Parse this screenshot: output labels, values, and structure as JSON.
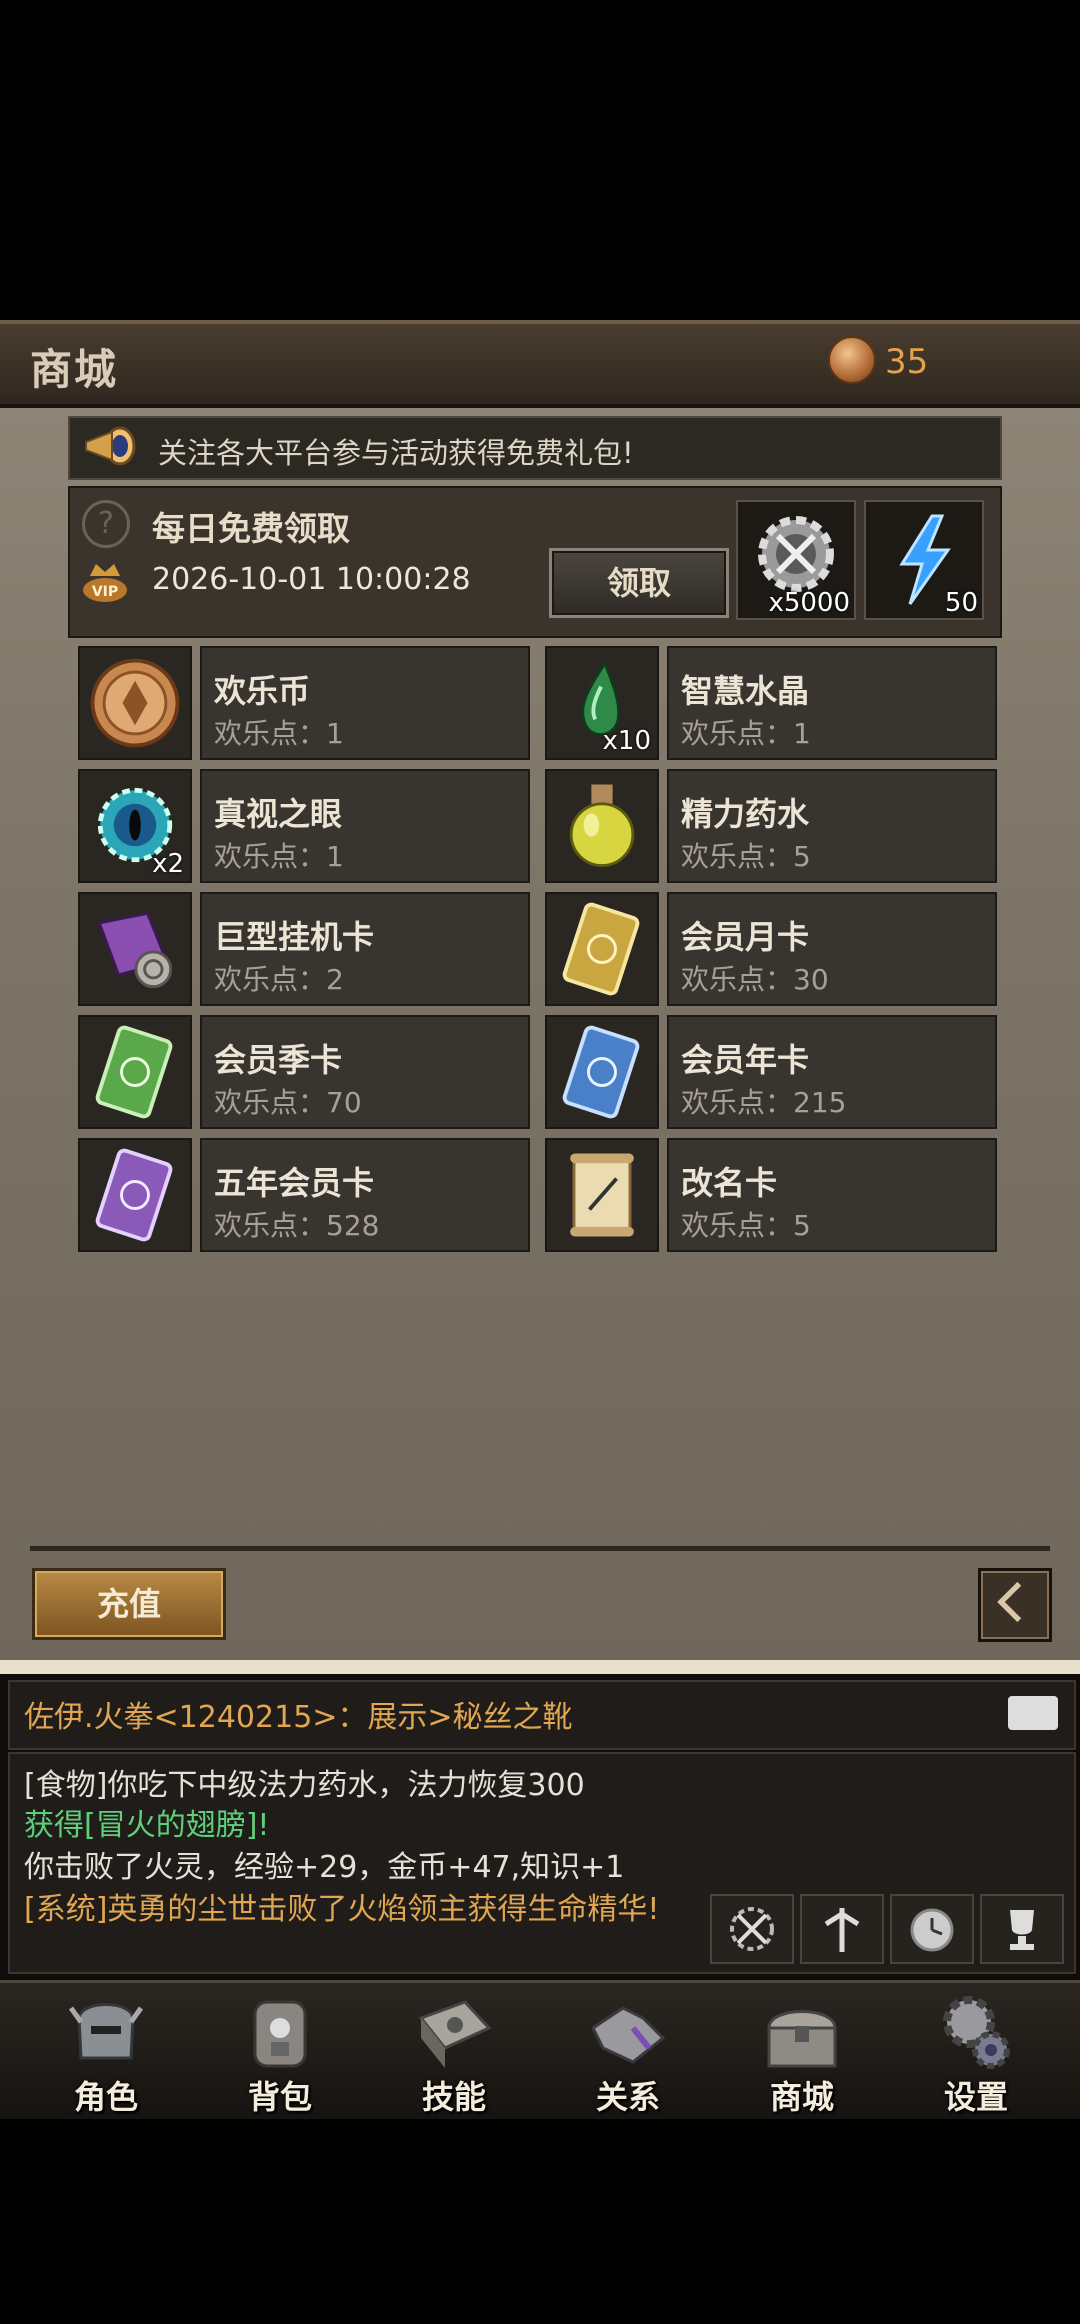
{
  "header": {
    "title": "商城",
    "currency_value": "35"
  },
  "notice": {
    "text": "关注各大平台参与活动获得免费礼包!"
  },
  "daily": {
    "title": "每日免费领取",
    "time": "2026-10-01 10:00:28",
    "claim_label": "领取",
    "rewards": [
      {
        "icon": "gear-swords-icon",
        "qty": "x5000"
      },
      {
        "icon": "lightning-icon",
        "qty": "50"
      }
    ]
  },
  "shop": {
    "items": [
      {
        "name": "欢乐币",
        "price": "欢乐点：1",
        "qty": "",
        "icon": "coin-icon"
      },
      {
        "name": "智慧水晶",
        "price": "欢乐点：1",
        "qty": "x10",
        "icon": "green-crystal-icon"
      },
      {
        "name": "真视之眼",
        "price": "欢乐点：1",
        "qty": "x2",
        "icon": "eye-icon"
      },
      {
        "name": "精力药水",
        "price": "欢乐点：5",
        "qty": "",
        "icon": "potion-icon"
      },
      {
        "name": "巨型挂机卡",
        "price": "欢乐点：2",
        "qty": "",
        "icon": "scroll-icon"
      },
      {
        "name": "会员月卡",
        "price": "欢乐点：30",
        "qty": "",
        "icon": "gold-card-icon"
      },
      {
        "name": "会员季卡",
        "price": "欢乐点：70",
        "qty": "",
        "icon": "green-card-icon"
      },
      {
        "name": "会员年卡",
        "price": "欢乐点：215",
        "qty": "",
        "icon": "blue-card-icon"
      },
      {
        "name": "五年会员卡",
        "price": "欢乐点：528",
        "qty": "",
        "icon": "purple-card-icon"
      },
      {
        "name": "改名卡",
        "price": "欢乐点：5",
        "qty": "",
        "icon": "parchment-icon"
      }
    ]
  },
  "recharge_label": "充值",
  "chat": {
    "top_message": "佐伊.火拳<1240215>：展示>秘丝之靴",
    "log": [
      {
        "text": "[食物]你吃下中级法力药水，法力恢复300",
        "color": "#e6e0d6"
      },
      {
        "text": "获得[冒火的翅膀]!",
        "color": "#5fd07a"
      },
      {
        "text": "你击败了火灵，经验+29，金币+47,知识+1",
        "color": "#e6e0d6"
      },
      {
        "text": "[系统]英勇的尘世击败了火焰领主获得生命精华!",
        "color": "#e0a651"
      }
    ]
  },
  "nav": [
    {
      "label": "角色",
      "icon": "helmet-icon"
    },
    {
      "label": "背包",
      "icon": "backpack-icon"
    },
    {
      "label": "技能",
      "icon": "spellbook-icon"
    },
    {
      "label": "关系",
      "icon": "handshake-icon"
    },
    {
      "label": "商城",
      "icon": "chest-icon"
    },
    {
      "label": "设置",
      "icon": "gear-icon"
    }
  ]
}
